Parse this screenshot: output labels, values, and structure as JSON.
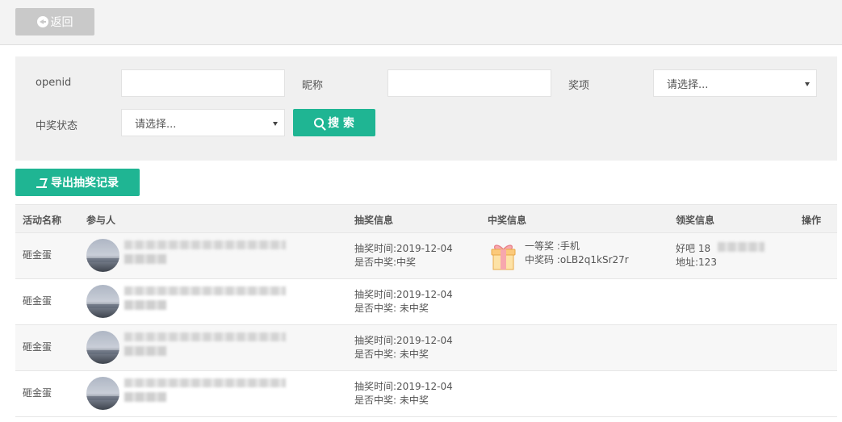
{
  "header": {
    "back_label": "返回"
  },
  "filters": {
    "openid_label": "openid",
    "nickname_label": "昵称",
    "prize_label": "奖项",
    "prize_placeholder": "请选择...",
    "status_label": "中奖状态",
    "status_placeholder": "请选择...",
    "search_label": "搜 索"
  },
  "toolbar": {
    "export_label": "导出抽奖记录"
  },
  "table": {
    "columns": [
      "活动名称",
      "参与人",
      "抽奖信息",
      "中奖信息",
      "领奖信息",
      "操作"
    ],
    "rows": [
      {
        "activity": "砸金蛋",
        "draw_time": "抽奖时间:2019-12-04",
        "win_status": "是否中奖:中奖",
        "prize_line": "一等奖  :手机",
        "code_line": "中奖码  :oLB2q1kSr27r",
        "claim_name": "好吧   18",
        "claim_address": "地址:123"
      },
      {
        "activity": "砸金蛋",
        "draw_time": "抽奖时间:2019-12-04",
        "win_status": "是否中奖: 未中奖"
      },
      {
        "activity": "砸金蛋",
        "draw_time": "抽奖时间:2019-12-04",
        "win_status": "是否中奖: 未中奖"
      },
      {
        "activity": "砸金蛋",
        "draw_time": "抽奖时间:2019-12-04",
        "win_status": "是否中奖: 未中奖"
      }
    ]
  },
  "colors": {
    "primary": "#1fb593",
    "back_button": "#c9c9c9",
    "panel": "#f0f0f0"
  },
  "icons": {
    "back": "arrow-left-circle-icon",
    "search": "search-icon",
    "export": "export-icon",
    "prize": "gift-icon"
  }
}
